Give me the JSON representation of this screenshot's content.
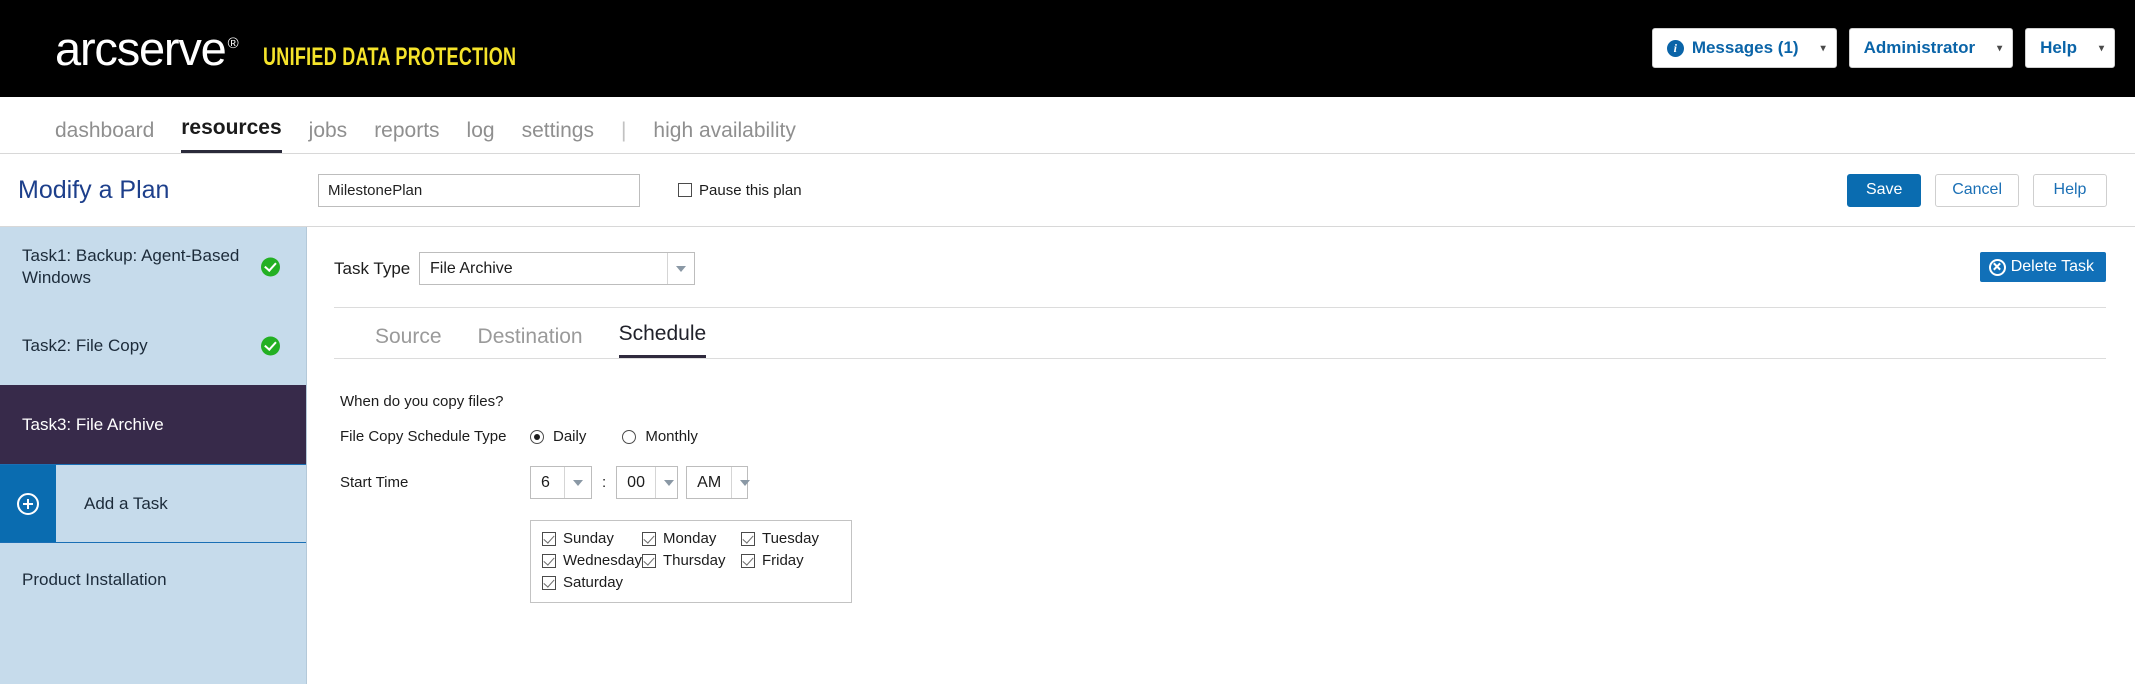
{
  "header": {
    "brand": "arcserve",
    "brand_reg": "®",
    "brand_sub": "UNIFIED DATA PROTECTION",
    "messages_label": "Messages (1)",
    "messages_icon": "info-icon",
    "administrator_label": "Administrator",
    "help_label": "Help",
    "caret": "▾",
    "info_letter": "i"
  },
  "nav": {
    "items": [
      {
        "label": "dashboard",
        "active": false
      },
      {
        "label": "resources",
        "active": true
      },
      {
        "label": "jobs",
        "active": false
      },
      {
        "label": "reports",
        "active": false
      },
      {
        "label": "log",
        "active": false
      },
      {
        "label": "settings",
        "active": false
      }
    ],
    "separator": "|",
    "trailing": {
      "label": "high availability"
    }
  },
  "toolbar": {
    "title": "Modify a Plan",
    "plan_name_value": "MilestonePlan",
    "plan_name_placeholder": "",
    "pause_label": "Pause this plan",
    "pause_checked": false,
    "save_label": "Save",
    "cancel_label": "Cancel",
    "help_label": "Help",
    "accent_color": "#0a6cb0"
  },
  "sidebar": {
    "background_color": "#c6dbeb",
    "selected_color": "#372a4a",
    "tasks": [
      {
        "label": "Task1: Backup: Agent-Based Windows",
        "status": "ok",
        "selected": false
      },
      {
        "label": "Task2: File Copy",
        "status": "ok",
        "selected": false
      },
      {
        "label": "Task3: File Archive",
        "status": "none",
        "selected": true
      }
    ],
    "add_task_label": "Add a Task",
    "add_task_icon": "plus-circle-icon",
    "product_installation_label": "Product Installation"
  },
  "main": {
    "task_type_label": "Task Type",
    "task_type_value": "File Archive",
    "delete_task_label": "Delete Task",
    "delete_task_icon": "close-circle-icon",
    "tabs": [
      {
        "label": "Source",
        "active": false
      },
      {
        "label": "Destination",
        "active": false
      },
      {
        "label": "Schedule",
        "active": true
      }
    ],
    "schedule": {
      "question": "When do you copy files?",
      "schedule_type_label": "File Copy Schedule Type",
      "schedule_type_options": [
        {
          "label": "Daily",
          "selected": true
        },
        {
          "label": "Monthly",
          "selected": false
        }
      ],
      "start_time_label": "Start Time",
      "start_time_hour": "6",
      "start_time_minute": "00",
      "start_time_meridiem": "AM",
      "time_separator": ":",
      "days": [
        {
          "label": "Sunday",
          "checked": true
        },
        {
          "label": "Monday",
          "checked": true
        },
        {
          "label": "Tuesday",
          "checked": true
        },
        {
          "label": "Wednesday",
          "checked": true
        },
        {
          "label": "Thursday",
          "checked": true
        },
        {
          "label": "Friday",
          "checked": true
        },
        {
          "label": "Saturday",
          "checked": true
        }
      ]
    }
  }
}
